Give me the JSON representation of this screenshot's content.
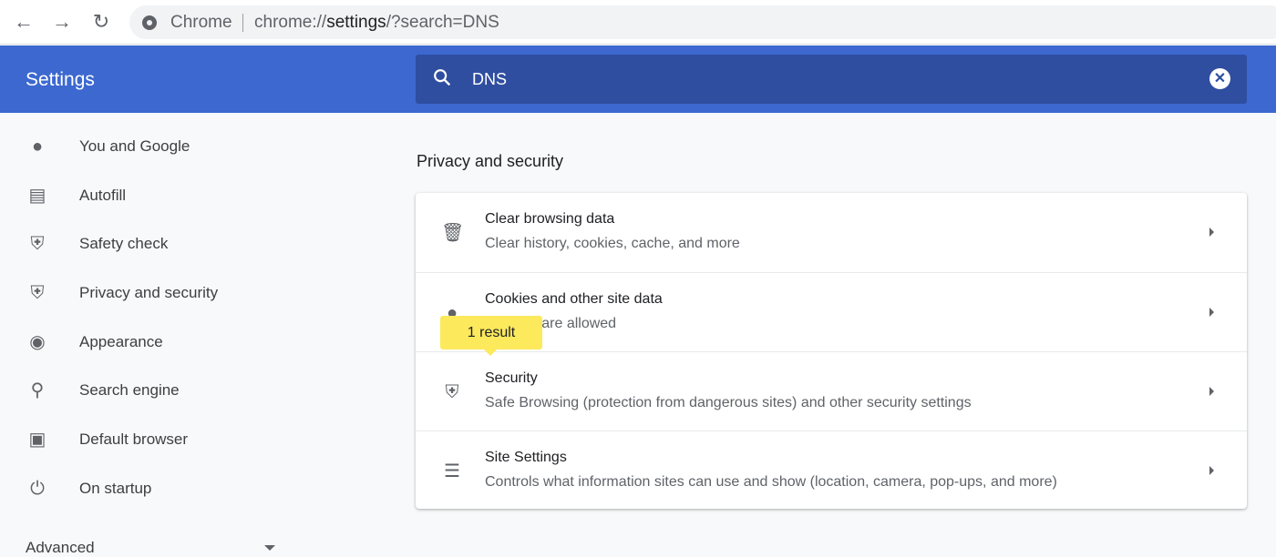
{
  "browser": {
    "chip_label": "Chrome",
    "url_prefix": "chrome://",
    "url_host": "settings",
    "url_rest": "/?search=DNS"
  },
  "header": {
    "title": "Settings",
    "search_value": "DNS"
  },
  "sidebar": {
    "items": [
      {
        "label": "You and Google",
        "icon": "person-icon"
      },
      {
        "label": "Autofill",
        "icon": "clipboard-icon"
      },
      {
        "label": "Safety check",
        "icon": "shield-check-icon"
      },
      {
        "label": "Privacy and security",
        "icon": "shield-icon"
      },
      {
        "label": "Appearance",
        "icon": "palette-icon"
      },
      {
        "label": "Search engine",
        "icon": "search-icon"
      },
      {
        "label": "Default browser",
        "icon": "browser-icon"
      },
      {
        "label": "On startup",
        "icon": "power-icon"
      }
    ],
    "advanced": "Advanced"
  },
  "main": {
    "section_title": "Privacy and security",
    "rows": [
      {
        "title": "Clear browsing data",
        "subtitle": "Clear history, cookies, cache, and more",
        "icon": "trash-icon"
      },
      {
        "title": "Cookies and other site data",
        "subtitle": "Cookies are allowed",
        "icon": "cookie-icon"
      },
      {
        "title": "Security",
        "subtitle": "Safe Browsing (protection from dangerous sites) and other security settings",
        "icon": "shield-icon"
      },
      {
        "title": "Site Settings",
        "subtitle": "Controls what information sites can use and show (location, camera, pop-ups, and more)",
        "icon": "sliders-icon"
      }
    ],
    "result_bubble": "1 result"
  },
  "colors": {
    "header": "#3c68d0",
    "search": "#2f4ea0",
    "bubble": "#fce95c"
  }
}
